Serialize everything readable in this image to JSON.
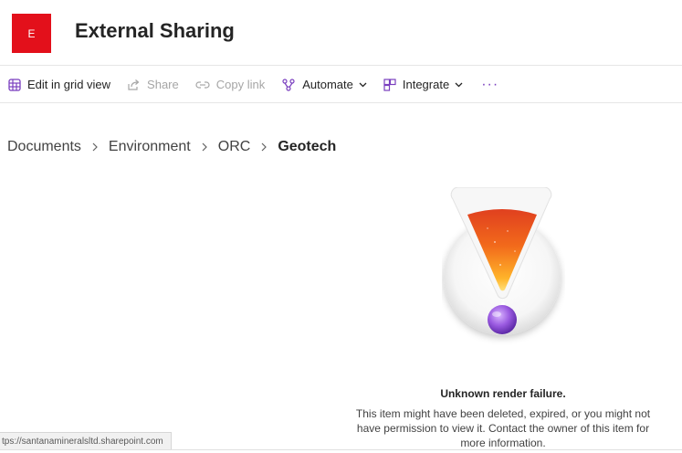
{
  "site": {
    "logo_letter": "E",
    "title": "External Sharing",
    "brand_color": "#e3101b"
  },
  "commandbar": {
    "edit_grid_label": "Edit in grid view",
    "share_label": "Share",
    "copy_link_label": "Copy link",
    "automate_label": "Automate",
    "integrate_label": "Integrate",
    "more_label": "···",
    "accent_color": "#7a3fbf"
  },
  "breadcrumb": {
    "items": [
      "Documents",
      "Environment",
      "ORC",
      "Geotech"
    ]
  },
  "error": {
    "title": "Unknown render failure.",
    "line1": "This item might have been deleted, expired, or you might not",
    "line2": "have permission to view it. Contact the owner of this item for",
    "line3": "more information."
  },
  "statusbar": {
    "url": "tps://santanamineralsltd.sharepoint.com"
  }
}
